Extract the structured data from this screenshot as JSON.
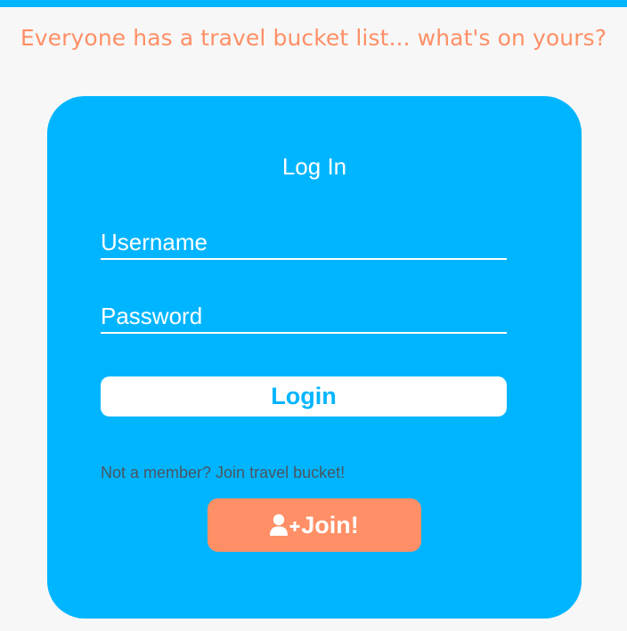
{
  "header": {
    "tagline": "Everyone has a travel bucket list... what's on yours?"
  },
  "login_card": {
    "title": "Log In",
    "username_placeholder": "Username",
    "password_placeholder": "Password",
    "login_label": "Login",
    "member_prompt": "Not a member? Join travel bucket!",
    "join_label": "Join!",
    "join_icon": "user-plus-icon"
  },
  "colors": {
    "accent_blue": "#00b5ff",
    "accent_orange": "#ff8f66",
    "background": "#f7f7f7"
  }
}
